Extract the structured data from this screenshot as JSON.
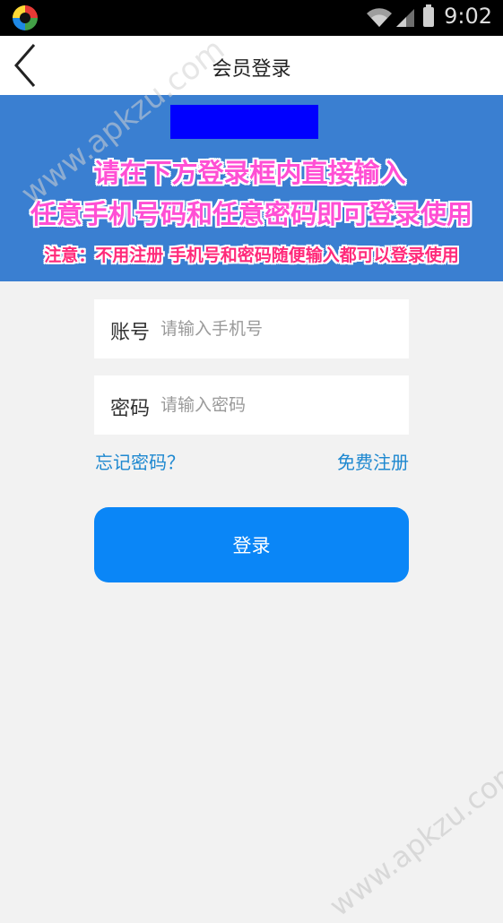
{
  "status_bar": {
    "time": "9:02",
    "icons": [
      "app-logo-icon",
      "wifi-icon",
      "signal-icon",
      "battery-icon"
    ]
  },
  "nav": {
    "title": "会员登录",
    "back_icon": "chevron-left-icon"
  },
  "banner": {
    "line1": "请在下方登录框内直接输入",
    "line2": "任意手机号码和任意密码即可登录使用",
    "note": "注意：不用注册 手机号和密码随便输入都可以登录使用",
    "colors": {
      "background": "#3a7fd1",
      "highlight_box": "#0000ff",
      "text": "#ff4fd4"
    }
  },
  "form": {
    "account_label": "账号",
    "account_value": "",
    "account_placeholder": "请输入手机号",
    "password_label": "密码",
    "password_value": "",
    "password_placeholder": "请输入密码",
    "forgot_link": "忘记密码？",
    "register_link": "免费注册",
    "login_button": "登录"
  },
  "watermark": {
    "text": "www.apkzu.com"
  },
  "colors": {
    "accent": "#0a86f7",
    "link": "#1e88d0",
    "page_background": "#f2f2f2"
  }
}
